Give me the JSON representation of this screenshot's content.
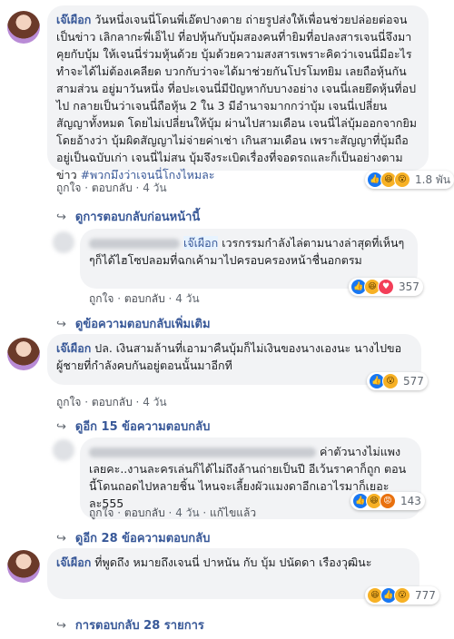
{
  "c1": {
    "name": "เจ๊เผือก",
    "text": "วันหนึ่งเจนนี่โดนพี่เอ๊ตปางตาย ถ่ายรูปส่งให้เพื่อนช่วยปล่อยต่อจนเป็นข่าว เลิกลากะพี่เอ็ไป ที่อปหุ้นกับบุ้มสองคนที่ายิมที่อปลงสารเจนนี่จึงมาคุยกับบุ้ม ให้เจนนี่ร่วมหุ้นด้วย บุ้มด้วยความสงสารเพราะคิดว่าเจนนี่มีอะไรทำจะได้ไม่ต้องเคลียด บวกกับว่าจะได้มาช่วยกันโปรโมทยิม เลยถือหุ้นกันสามส่วน อยู่มาวันหนึ่ง ที่อปะเจนนี่มีปัญหากับบางอย่าง เจนนี่เลยยึดหุ้นที่อปไป กลายเป็นว่าเจนนี่ถือหุ้น 2 ใน 3 มีอำนาจมากกว่าบุ้ม เจนนี่เปลี่ยนสัญญาทั้งหมด โดยไม่เปลี่ยนให้บุ้ม ผ่านไปสามเดือน เจนนี่ไล่บุ้มออกจากยิม โดยอ้างว่า บุ้มผิดสัญญาไม่จ่ายค่าเช่า เกินสามเดือน เพราะสัญญาที่บุ้มถืออยู่เป็นฉบับเก่า เจนนี่ไม่สน บุ้มจึงระเบิดเรื่องที่จอดรถและก็เป็นอย่างตามข่าว",
    "hashtag": "#พวกมึงว่าเจนนี่โกงไหมละ",
    "like": "ถูกใจ",
    "reply": "ตอบกลับ",
    "time": "4 วัน",
    "reactions": "1.8 พัน"
  },
  "more1": "ดูการตอบกลับก่อนหน้านี้",
  "r1": {
    "mention": "เจ๊เผือก",
    "text": "เวรกรรมกำลังไล่ตามนางล่าสุดที่เห็นๆๆก็ได้ไฮโซปลอมที่ฉกเค้ามาไปครอบครองหน้าชื่นอกตรม",
    "like": "ถูกใจ",
    "reply": "ตอบกลับ",
    "time": "4 วัน",
    "reactions": "357"
  },
  "more2": "ดูข้อความตอบกลับเพิ่มเติม",
  "c2": {
    "name": "เจ๊เผือก",
    "text": "ปล. เงินสามล้านที่เอามาคืนบุ้มก็ไม่เงินของนางเองนะ นางไปขอผู้ชายที่กำลังคบกันอยู่ตอนนั้นมาอีกที",
    "like": "ถูกใจ",
    "reply": "ตอบกลับ",
    "time": "4 วัน",
    "reactions": "577"
  },
  "more3": "ดูอีก 15 ข้อความตอบกลับ",
  "r2": {
    "text": "ค่าตัวนางไม่แพงเลยคะ..งานละครเล่นก็ได้ไม่ถึงล้านถ่ายเป็นปี อีเว้นราคาก็ถูก ตอนนี้โดนถอดไปหลายชิ้น ไหนจะเลี้ยงผัวแมงดาอีกเอาไรมาก็เยอะละ555",
    "like": "ถูกใจ",
    "reply": "ตอบกลับ",
    "time": "4 วัน",
    "edited": "แก้ไขแล้ว",
    "reactions": "143"
  },
  "more4": "ดูอีก 28 ข้อความตอบกลับ",
  "c3": {
    "name": "เจ๊เผือก",
    "text": "ที่พูดถึง หมายถึงเจนนี่ ปาหนัน กับ บุ้ม ปนัดดา เรืองวุฒินะ",
    "reactions": "777"
  },
  "more5": "การตอบกลับ 28 รายการ"
}
